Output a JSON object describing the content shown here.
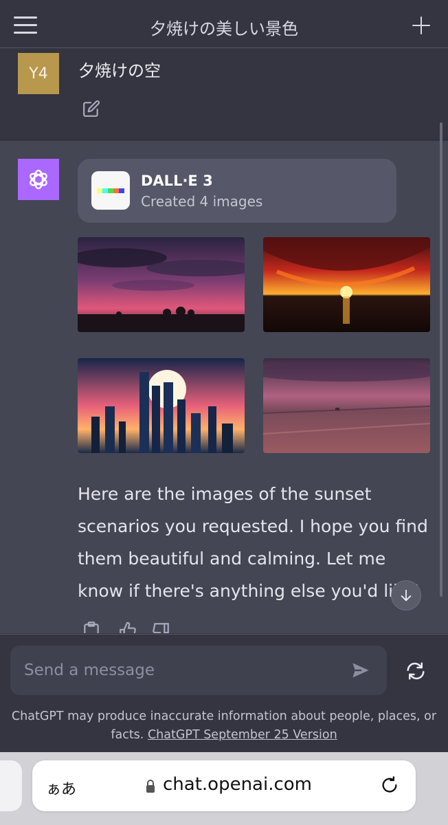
{
  "header": {
    "title": "夕焼けの美しい景色",
    "menu_icon": "hamburger-menu-icon",
    "new_chat_icon": "plus-icon"
  },
  "user_message": {
    "avatar_text": "Y4",
    "avatar_color": "#b8984c",
    "text": "夕焼けの空"
  },
  "assistant_message": {
    "avatar_color": "#ab68ff",
    "tool": {
      "name": "DALL·E 3",
      "status": "Created 4 images"
    },
    "images": [
      {
        "name": "sunset-silhouette-trees-image"
      },
      {
        "name": "sunset-ocean-fiery-clouds-image"
      },
      {
        "name": "sunset-city-skyline-image"
      },
      {
        "name": "sunset-farmland-image"
      }
    ],
    "reply": "Here are the images of the sunset scenarios you requested. I hope you find them beautiful and calming. Let me know if there's anything else you'd like!"
  },
  "composer": {
    "placeholder": "Send a message"
  },
  "disclaimer": {
    "text": "ChatGPT may produce inaccurate information about people, places, or facts. ",
    "link": "ChatGPT September 25 Version"
  },
  "browser": {
    "aa_label": "ぁあ",
    "url": "chat.openai.com"
  },
  "colors": {
    "background": "#343541",
    "assistant_background": "#444654",
    "accent": "#ab68ff"
  }
}
